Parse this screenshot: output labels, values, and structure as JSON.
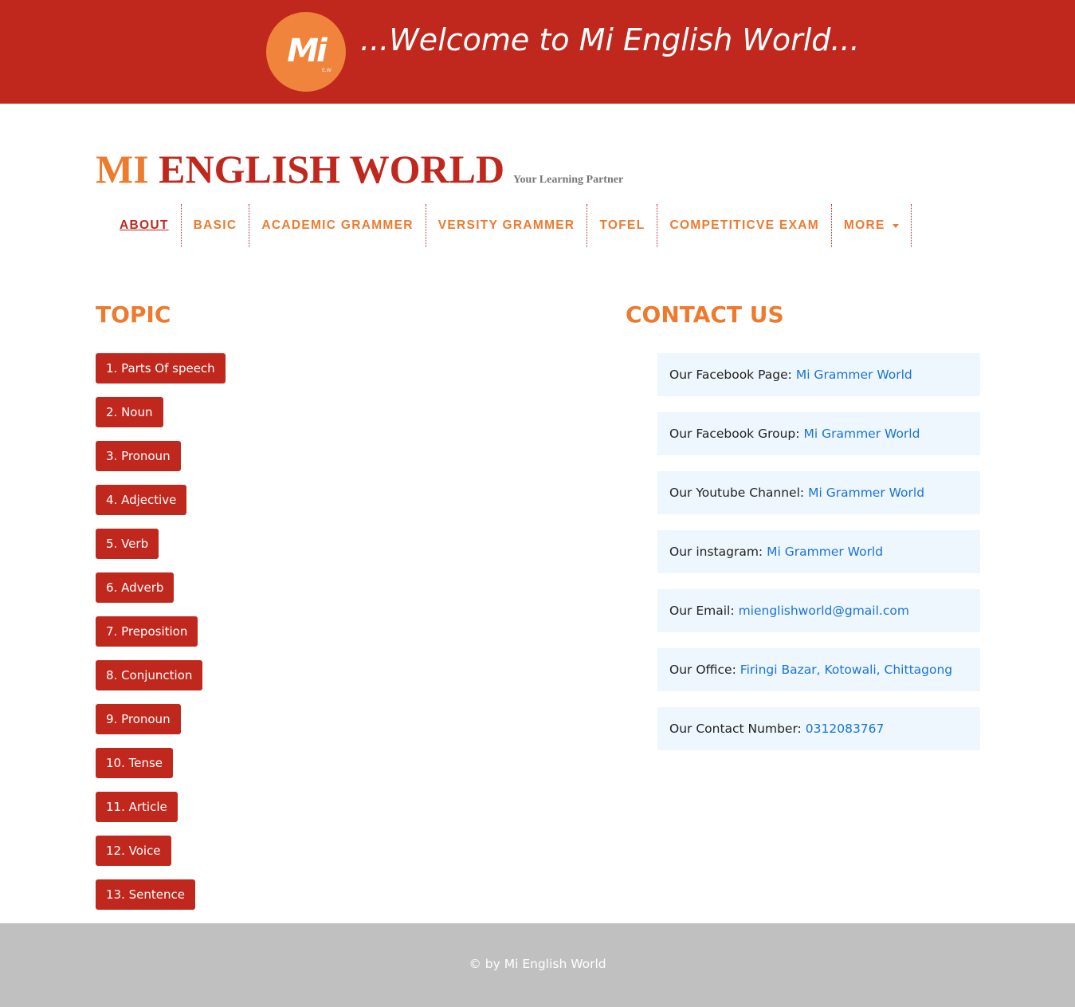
{
  "banner": {
    "logo_text": "Mi",
    "logo_subtext": "E.W",
    "welcome": "...Welcome to Mi English World..."
  },
  "brand": {
    "mi": "MI",
    "rest": "ENGLISH WORLD",
    "tagline": "Your Learning Partner"
  },
  "nav": {
    "items": [
      {
        "label": "ABOUT"
      },
      {
        "label": "BASIC"
      },
      {
        "label": "ACADEMIC GRAMMER"
      },
      {
        "label": "VERSITY GRAMMER"
      },
      {
        "label": "TOFEL"
      },
      {
        "label": "COMPETITICVE EXAM"
      },
      {
        "label": "MORE"
      }
    ]
  },
  "topics": {
    "heading": "TOPIC",
    "items": [
      "1. Parts Of speech",
      "2. Noun",
      "3. Pronoun",
      "4. Adjective",
      "5. Verb",
      "6. Adverb",
      "7. Preposition",
      "8. Conjunction",
      "9. Pronoun",
      "10. Tense",
      "11. Article",
      "12. Voice",
      "13. Sentence"
    ]
  },
  "contact": {
    "heading": "CONTACT US",
    "items": [
      {
        "label": "Our Facebook Page:",
        "value": "Mi Grammer World"
      },
      {
        "label": "Our Facebook Group:",
        "value": "Mi Grammer World"
      },
      {
        "label": "Our Youtube Channel:",
        "value": "Mi Grammer World"
      },
      {
        "label": "Our instagram:",
        "value": "Mi Grammer World"
      },
      {
        "label": "Our Email:",
        "value": "mienglishworld@gmail.com"
      },
      {
        "label": "Our Office:",
        "value": "Firingi Bazar, Kotowali, Chittagong"
      },
      {
        "label": "Our Contact Number:",
        "value": "0312083767"
      }
    ]
  },
  "footer": {
    "text": "© by Mi English World"
  },
  "colors": {
    "primary_red": "#c0281e",
    "accent_orange": "#ee7a2e",
    "link_blue": "#1a73d9",
    "card_bg": "#eef7fe",
    "footer_bg": "#c0c0c0"
  },
  "icons": {
    "more_dropdown": "caret-down-icon"
  }
}
